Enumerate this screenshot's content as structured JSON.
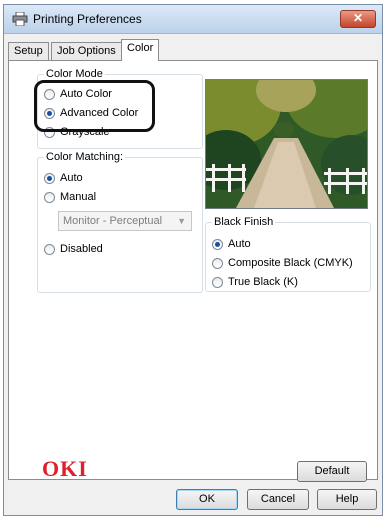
{
  "window": {
    "title": "Printing Preferences",
    "close_label": "✕"
  },
  "tabs": [
    {
      "label": "Setup",
      "active": false
    },
    {
      "label": "Job Options",
      "active": false
    },
    {
      "label": "Color",
      "active": true
    }
  ],
  "color_mode": {
    "label": "Color Mode",
    "options": [
      {
        "label": "Auto Color",
        "checked": false
      },
      {
        "label": "Advanced Color",
        "checked": true
      },
      {
        "label": "Grayscale",
        "checked": false
      }
    ]
  },
  "color_matching": {
    "label": "Color Matching:",
    "options": [
      {
        "label": "Auto",
        "checked": true
      },
      {
        "label": "Manual",
        "checked": false
      },
      {
        "label": "Disabled",
        "checked": false
      }
    ],
    "select_value": "Monitor - Perceptual"
  },
  "black_finish": {
    "label": "Black Finish",
    "options": [
      {
        "label": "Auto",
        "checked": true
      },
      {
        "label": "Composite Black (CMYK)",
        "checked": false
      },
      {
        "label": "True Black (K)",
        "checked": false
      }
    ]
  },
  "brand": {
    "logo_text": "OKI",
    "logo_color": "#e0202a"
  },
  "buttons": {
    "default_label": "Default",
    "ok_label": "OK",
    "cancel_label": "Cancel",
    "help_label": "Help"
  },
  "colors": {
    "accent_radio": "#1a4fa8",
    "title_bar": "#c9dcf0"
  }
}
